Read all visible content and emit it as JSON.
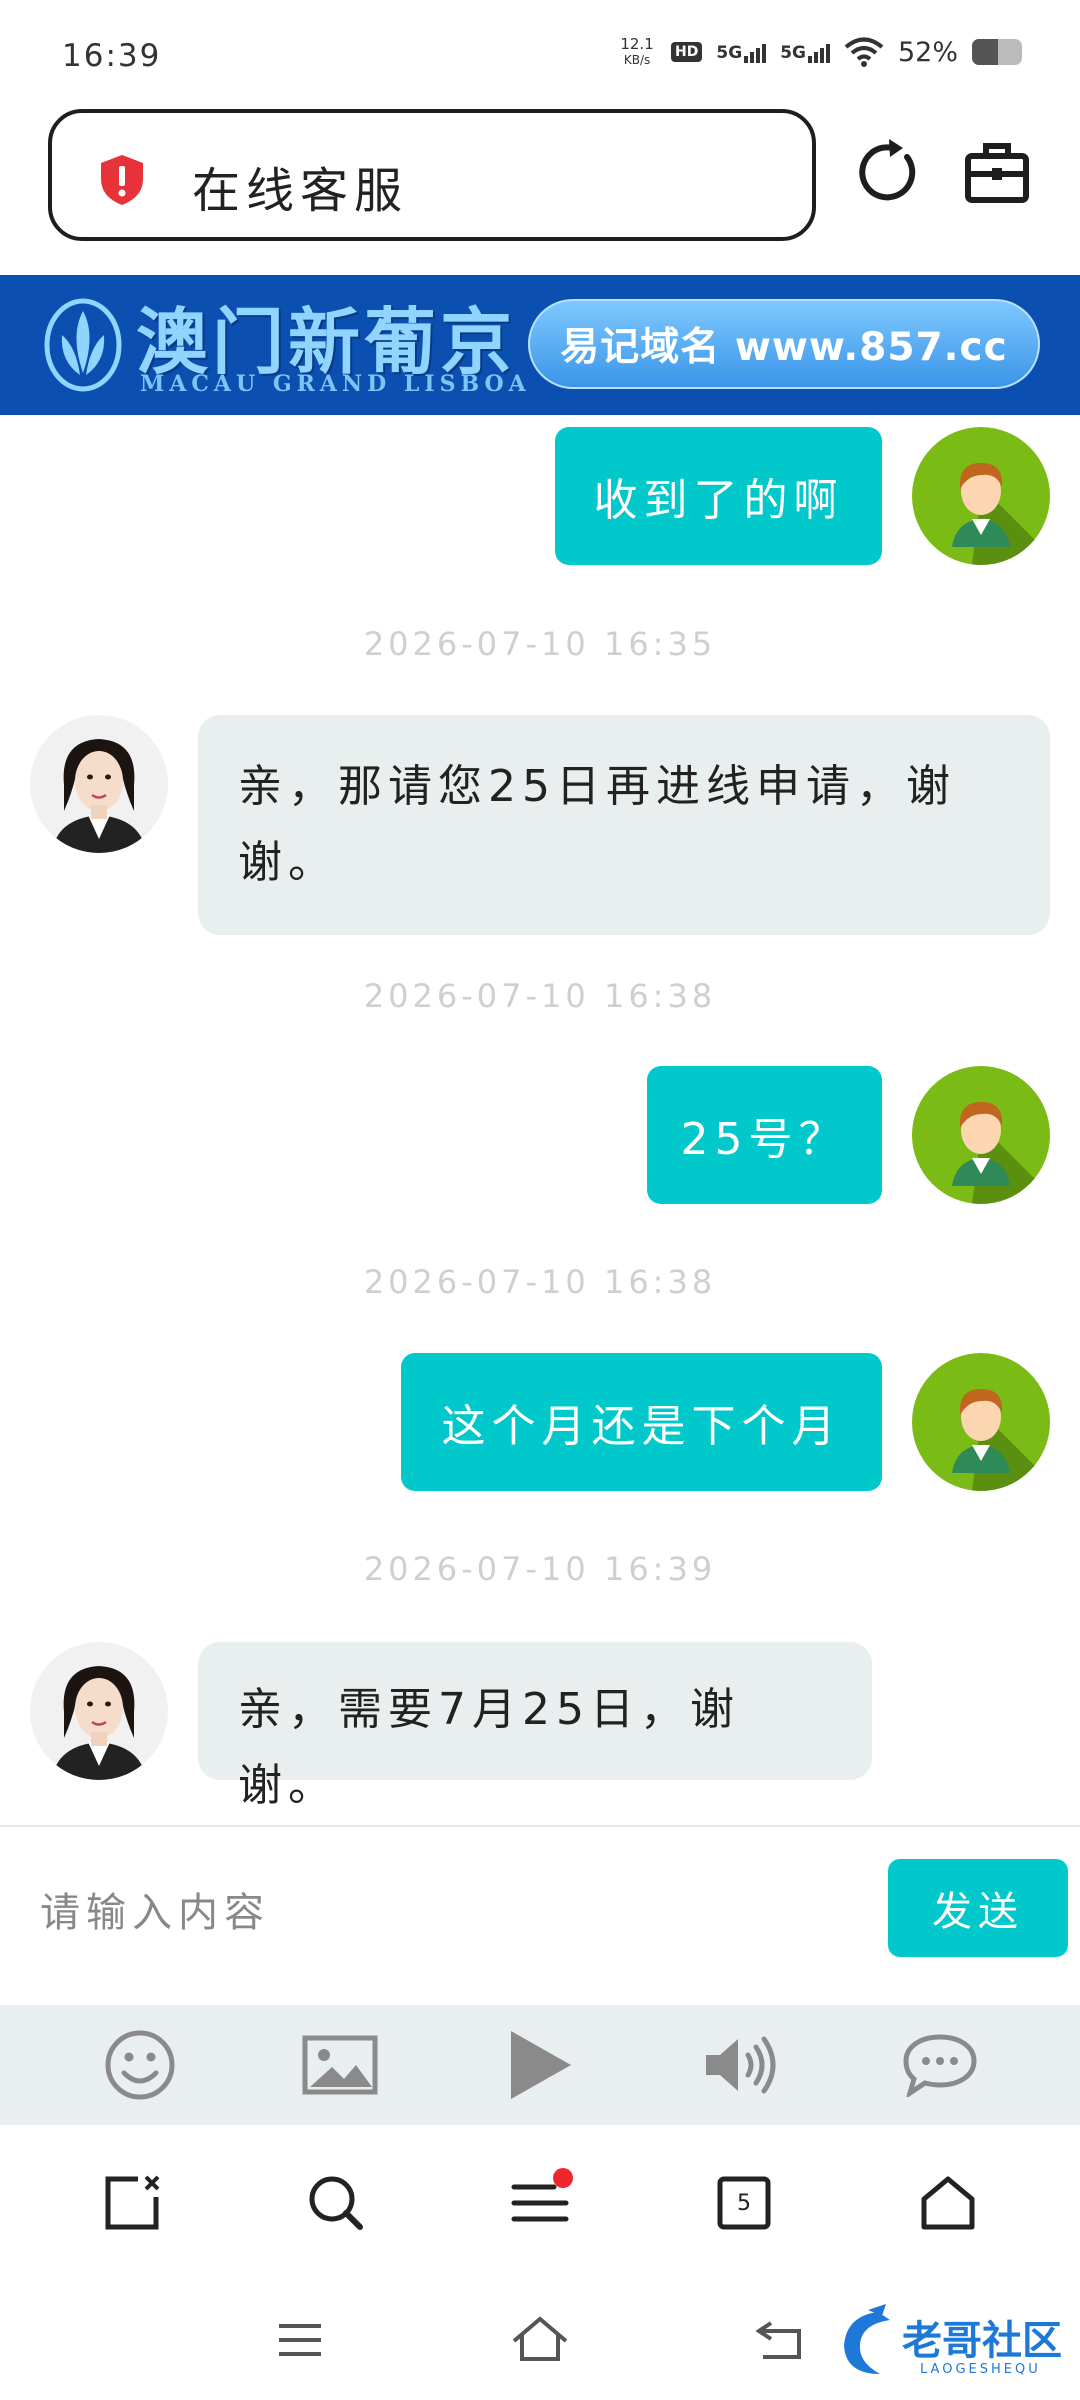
{
  "status_bar": {
    "time": "16:39",
    "net_speed_value": "12.1",
    "net_speed_unit": "KB/s",
    "hd_label": "HD",
    "sim1_label": "5G",
    "sim2_label": "5G",
    "battery_text": "52%",
    "battery_level": 0.52
  },
  "browser": {
    "url_title": "在线客服"
  },
  "banner": {
    "brand_name": "澳门新葡京",
    "brand_sub": "MACAU GRAND LISBOA",
    "domain_text": "易记域名 www.857.cc"
  },
  "chat": {
    "messages": [
      {
        "from": "user",
        "text": "收到了的啊"
      },
      {
        "from": "timestamp",
        "text": "2026-07-10 16:35"
      },
      {
        "from": "agent",
        "text": "亲，那请您25日再进线申请，谢谢。"
      },
      {
        "from": "timestamp",
        "text": "2026-07-10 16:38"
      },
      {
        "from": "user",
        "text": "25号？"
      },
      {
        "from": "timestamp",
        "text": "2026-07-10 16:38"
      },
      {
        "from": "user",
        "text": "这个月还是下个月"
      },
      {
        "from": "timestamp",
        "text": "2026-07-10 16:39"
      },
      {
        "from": "agent",
        "text": "亲，需要7月25日，谢谢。"
      }
    ]
  },
  "composer": {
    "placeholder": "请输入内容",
    "send_label": "发送"
  },
  "toolbar": {
    "icons": [
      "emoji-icon",
      "image-icon",
      "play-icon",
      "volume-icon",
      "chat-bubble-icon"
    ]
  },
  "bottom_nav": {
    "tab_count": "5",
    "menu_has_notification": true
  },
  "watermark": {
    "text": "老哥社区",
    "sub": "LAOGESHEQU"
  },
  "colors": {
    "accent": "#00c8cb",
    "banner_bg": "#0b4fb1",
    "user_avatar": "#7bbb16",
    "notification": "#f0262e"
  }
}
